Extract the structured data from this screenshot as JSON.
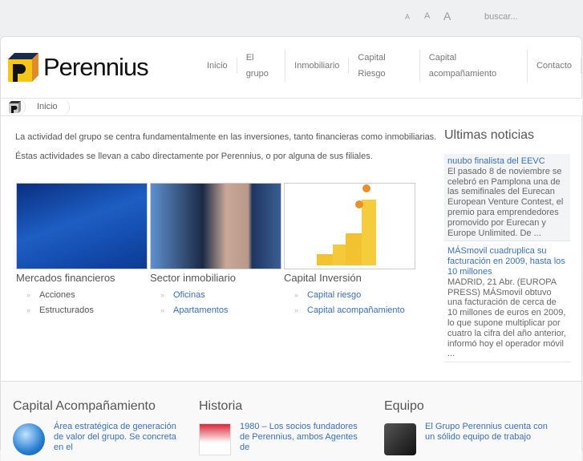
{
  "top": {
    "font_small": "A",
    "font_medium": "A",
    "font_large": "A",
    "search_placeholder": "buscar..."
  },
  "brand": {
    "name": "Perennius"
  },
  "nav": [
    "Inicio",
    "El grupo",
    "Inmobiliario",
    "Capital Riesgo",
    "Capital acompañamiento",
    "Contacto"
  ],
  "breadcrumb": {
    "current": "Inicio"
  },
  "intro": [
    "La actividad del grupo se centra fundamentalmente en las inversiones, tanto financieras como inmobiliarias.",
    "Éstas actividades se llevan a cabo directamente por Perennius, o por alguna de sus filiales."
  ],
  "sections": [
    {
      "title": "Mercados financieros",
      "items": [
        "Acciones",
        "Estructurados"
      ]
    },
    {
      "title": "Sector inmobiliario",
      "items": [
        "Oficinas",
        "Apartamentos"
      ]
    },
    {
      "title": "Capital Inversión",
      "items": [
        "Capital riesgo",
        "Capital acompañamiento"
      ]
    }
  ],
  "news": {
    "title": "Ultimas noticias",
    "items": [
      {
        "headline": "nuubo finalista del EEVC",
        "body": "El pasado 8 de noviembre se celebró en Pamplona una de las semifinales del Eurecan European Venture Contest, el premio para emprendedores promovido por Eurecan y Europe Unlimited. De ..."
      },
      {
        "headline": "MÁSmovil cuadruplica su facturación en 2009, hasta los 10 millones",
        "body": "MADRID, 21 Abr. (EUROPA PRESS) MÁSmovil obtuvo una facturación de cerca de 10 millones de euros en 2009, lo que supone multiplicar por cuatro la cifra del año anterior, informó hoy el operador móvil ..."
      }
    ]
  },
  "footer": [
    {
      "title": "Capital Acompañamiento",
      "text": "Área estratégica de generación de valor del grupo. Se concreta en el"
    },
    {
      "title": "Historia",
      "text": "1980 – Los socios fundadores de Perennius, ambos Agentes de"
    },
    {
      "title": "Equipo",
      "text": "El Grupo Perennius cuenta con un sólido equipo de trabajo"
    }
  ]
}
